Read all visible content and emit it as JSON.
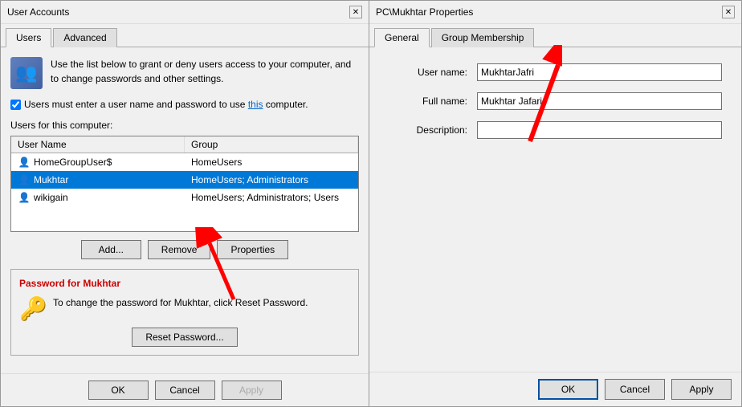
{
  "left": {
    "title": "User Accounts",
    "close_btn": "✕",
    "tabs": [
      {
        "label": "Users",
        "active": true
      },
      {
        "label": "Advanced",
        "active": false
      }
    ],
    "description": "Use the list below to grant or deny users access to your computer, and to change passwords and other settings.",
    "checkbox_label": "Users must enter a user name and password to use",
    "checkbox_link": "this",
    "checkbox_suffix": "computer.",
    "section_label": "Users for this computer:",
    "table": {
      "headers": [
        "User Name",
        "Group"
      ],
      "rows": [
        {
          "name": "HomeGroupUser$",
          "group": "HomeUsers",
          "selected": false
        },
        {
          "name": "Mukhtar",
          "group": "HomeUsers; Administrators",
          "selected": true
        },
        {
          "name": "wikigain",
          "group": "HomeUsers; Administrators; Users",
          "selected": false
        }
      ]
    },
    "buttons": {
      "add": "Add...",
      "remove": "Remove",
      "properties": "Properties"
    },
    "password_section": {
      "title": "Password for Mukhtar",
      "text": "To change the password for Mukhtar, click Reset Password.",
      "reset_btn": "Reset Password..."
    },
    "bottom_buttons": {
      "ok": "OK",
      "cancel": "Cancel",
      "apply": "Apply"
    }
  },
  "right": {
    "title": "PC\\Mukhtar Properties",
    "close_btn": "✕",
    "tabs": [
      {
        "label": "General",
        "active": true
      },
      {
        "label": "Group Membership",
        "active": false
      }
    ],
    "form": {
      "username_label": "User name:",
      "username_value": "MukhtarJafri",
      "fullname_label": "Full name:",
      "fullname_value": "Mukhtar Jafari",
      "description_label": "Description:",
      "description_value": ""
    },
    "bottom_buttons": {
      "ok": "OK",
      "cancel": "Cancel",
      "apply": "Apply"
    }
  }
}
